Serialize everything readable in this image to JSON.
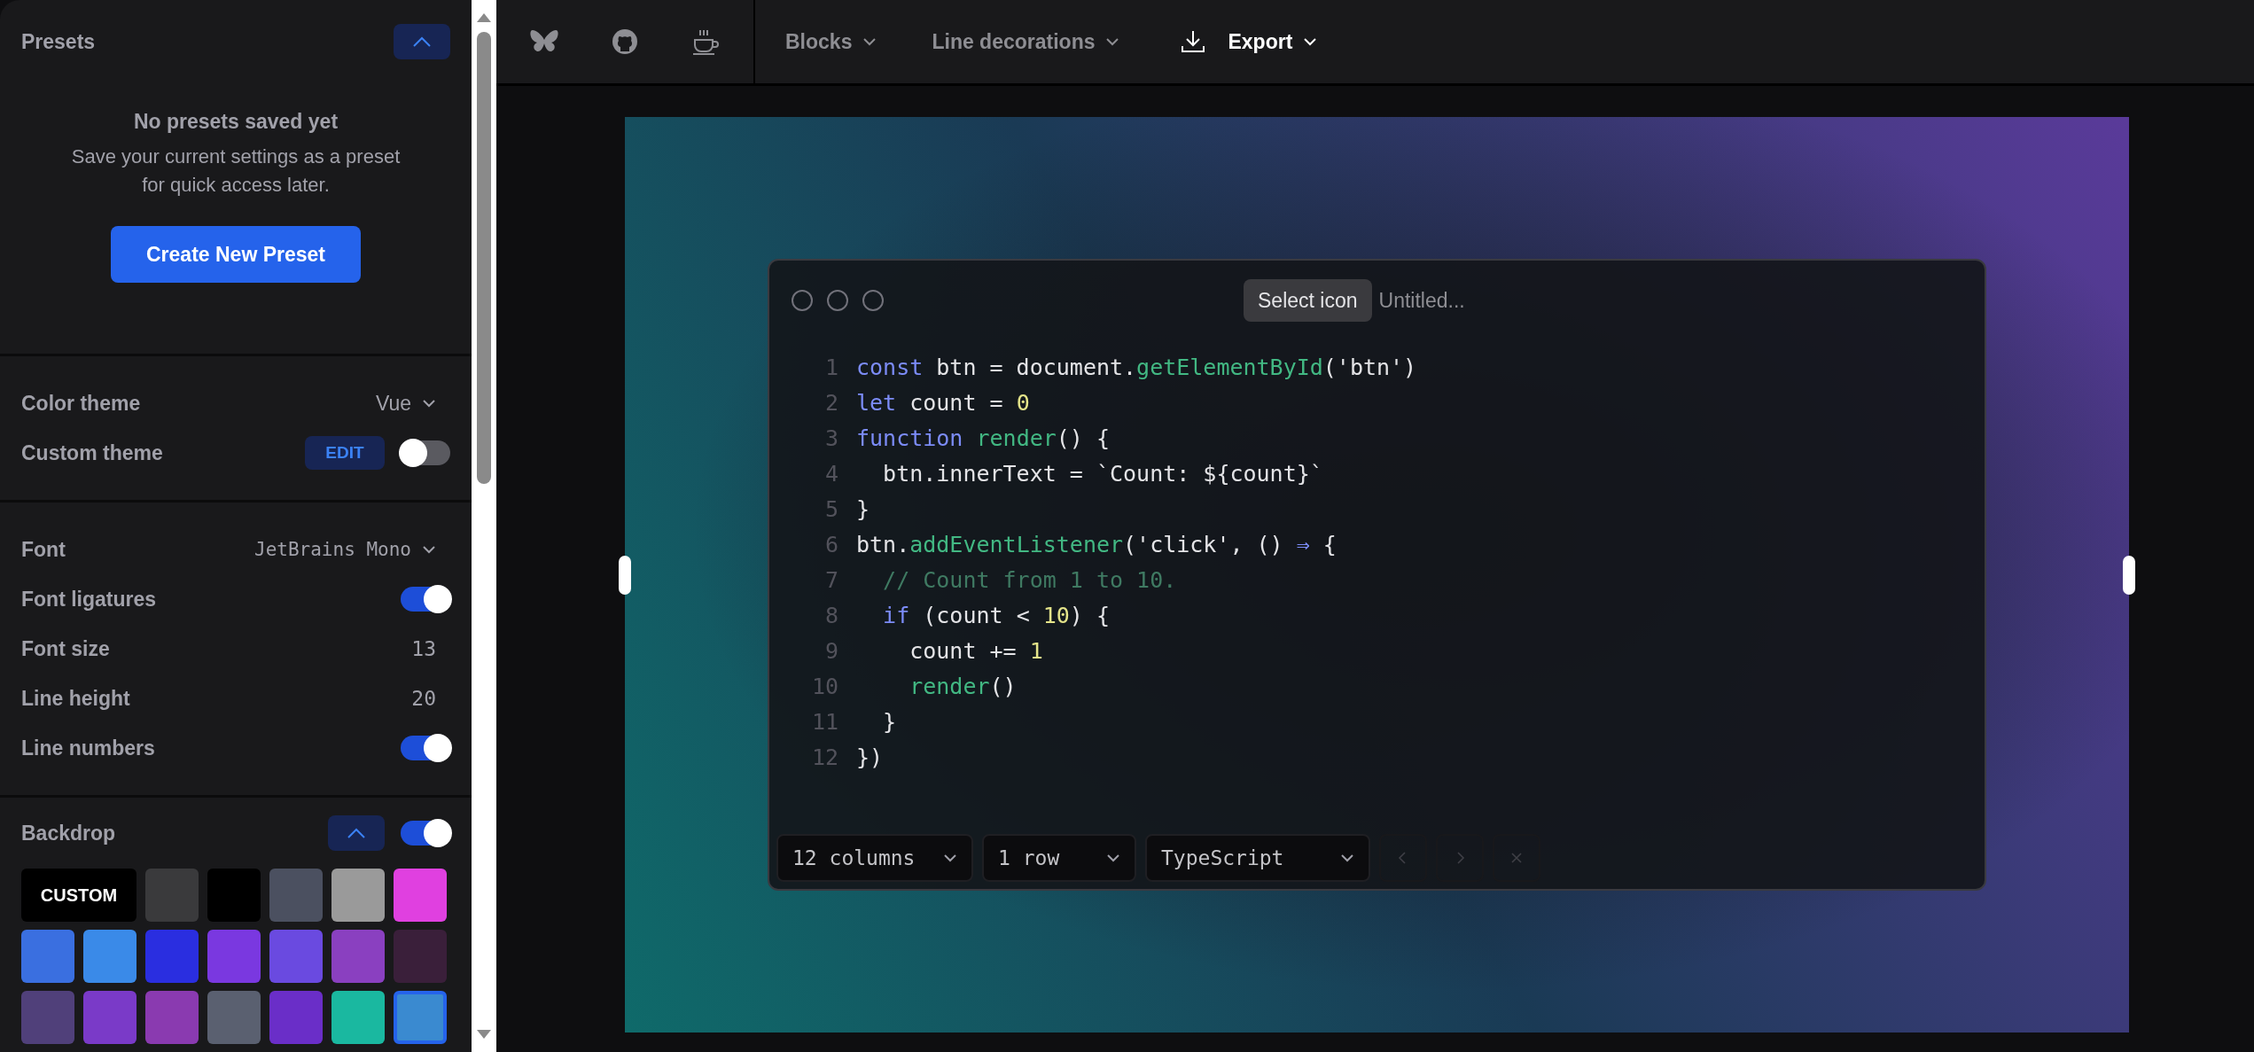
{
  "sidebar": {
    "presets": {
      "title": "Presets",
      "expanded": true,
      "empty_title": "No presets saved yet",
      "empty_text": "Save your current settings as a preset for quick access later.",
      "create_button": "Create New Preset"
    },
    "theme": [
      {
        "kind": "select",
        "label": "Color theme",
        "value": "Vue"
      },
      {
        "kind": "toggle",
        "label": "Custom theme",
        "edit_button": "EDIT",
        "on": false
      }
    ],
    "font": [
      {
        "kind": "select",
        "label": "Font",
        "value": "JetBrains Mono"
      },
      {
        "kind": "toggle",
        "label": "Font ligatures",
        "on": true
      },
      {
        "kind": "number",
        "label": "Font size",
        "value": "13"
      },
      {
        "kind": "number",
        "label": "Line height",
        "value": "20"
      },
      {
        "kind": "toggle",
        "label": "Line numbers",
        "on": true
      }
    ],
    "backdrop": {
      "title": "Backdrop",
      "expanded": true,
      "on": true,
      "custom_label": "CUSTOM",
      "swatches": [
        {
          "color": "#3a3a3c",
          "selected": false
        },
        {
          "color": "#000000",
          "selected": false
        },
        {
          "color": "#4b5060",
          "selected": false
        },
        {
          "color": "#9a9a9a",
          "selected": false
        },
        {
          "color": "#e040e0",
          "selected": false
        },
        {
          "color": "#3a6fe0",
          "selected": false
        },
        {
          "color": "#3a8ae8",
          "selected": false
        },
        {
          "color": "#2a2ee0",
          "selected": false
        },
        {
          "color": "#7a38e0",
          "selected": false
        },
        {
          "color": "#6a4ae0",
          "selected": false
        },
        {
          "color": "#8a40c0",
          "selected": false
        },
        {
          "color": "#3a1f3a",
          "selected": false
        },
        {
          "color": "#50407a",
          "selected": false
        },
        {
          "color": "#7a3ac8",
          "selected": false
        },
        {
          "color": "#8a3ab0",
          "selected": false
        },
        {
          "color": "#5a6070",
          "selected": false
        },
        {
          "color": "#6a2ec8",
          "selected": false
        },
        {
          "color": "#1ab8a0",
          "selected": false
        },
        {
          "color": "#3a8ad0",
          "selected": true
        }
      ]
    }
  },
  "toolbar": {
    "menus": [
      {
        "label": "Blocks",
        "kind": "menu"
      },
      {
        "label": "Line decorations",
        "kind": "menu"
      },
      {
        "label": "Export",
        "kind": "export"
      }
    ]
  },
  "editor": {
    "select_icon": "Select icon",
    "title_placeholder": "Untitled...",
    "lines": [
      {
        "number": "1",
        "tokens": [
          {
            "kind": "kw",
            "text": "const"
          },
          {
            "kind": "plain",
            "text": " btn = document."
          },
          {
            "kind": "fn",
            "text": "getElementById"
          },
          {
            "kind": "plain",
            "text": "('btn')"
          }
        ]
      },
      {
        "number": "2",
        "tokens": [
          {
            "kind": "kw",
            "text": "let"
          },
          {
            "kind": "plain",
            "text": " count = "
          },
          {
            "kind": "num",
            "text": "0"
          }
        ]
      },
      {
        "number": "3",
        "tokens": [
          {
            "kind": "kw",
            "text": "function"
          },
          {
            "kind": "fn",
            "text": " render"
          },
          {
            "kind": "plain",
            "text": "() {"
          }
        ]
      },
      {
        "number": "4",
        "tokens": [
          {
            "kind": "plain",
            "text": "  btn.innerText = `Count: ${count}`"
          }
        ]
      },
      {
        "number": "5",
        "tokens": [
          {
            "kind": "plain",
            "text": "}"
          }
        ]
      },
      {
        "number": "6",
        "tokens": [
          {
            "kind": "plain",
            "text": "btn."
          },
          {
            "kind": "fn",
            "text": "addEventListener"
          },
          {
            "kind": "plain",
            "text": "('click', () "
          },
          {
            "kind": "kw",
            "text": "⇒"
          },
          {
            "kind": "plain",
            "text": " {"
          }
        ]
      },
      {
        "number": "7",
        "tokens": [
          {
            "kind": "com",
            "text": "  // Count from 1 to 10."
          }
        ]
      },
      {
        "number": "8",
        "tokens": [
          {
            "kind": "kw",
            "text": "  if"
          },
          {
            "kind": "plain",
            "text": " (count < "
          },
          {
            "kind": "num",
            "text": "10"
          },
          {
            "kind": "plain",
            "text": ") {"
          }
        ]
      },
      {
        "number": "9",
        "tokens": [
          {
            "kind": "plain",
            "text": "    count += "
          },
          {
            "kind": "num",
            "text": "1"
          }
        ]
      },
      {
        "number": "10",
        "tokens": [
          {
            "kind": "fn",
            "text": "    render"
          },
          {
            "kind": "plain",
            "text": "()"
          }
        ]
      },
      {
        "number": "11",
        "tokens": [
          {
            "kind": "plain",
            "text": "  }"
          }
        ]
      },
      {
        "number": "12",
        "tokens": [
          {
            "kind": "plain",
            "text": "})"
          }
        ]
      }
    ],
    "footer": [
      {
        "kind": "select",
        "label": "12 columns"
      },
      {
        "kind": "select",
        "label": "1 row"
      },
      {
        "kind": "select",
        "label": "TypeScript"
      },
      {
        "kind": "prev",
        "disabled": true
      },
      {
        "kind": "next",
        "disabled": true
      },
      {
        "kind": "close",
        "disabled": true
      }
    ]
  }
}
